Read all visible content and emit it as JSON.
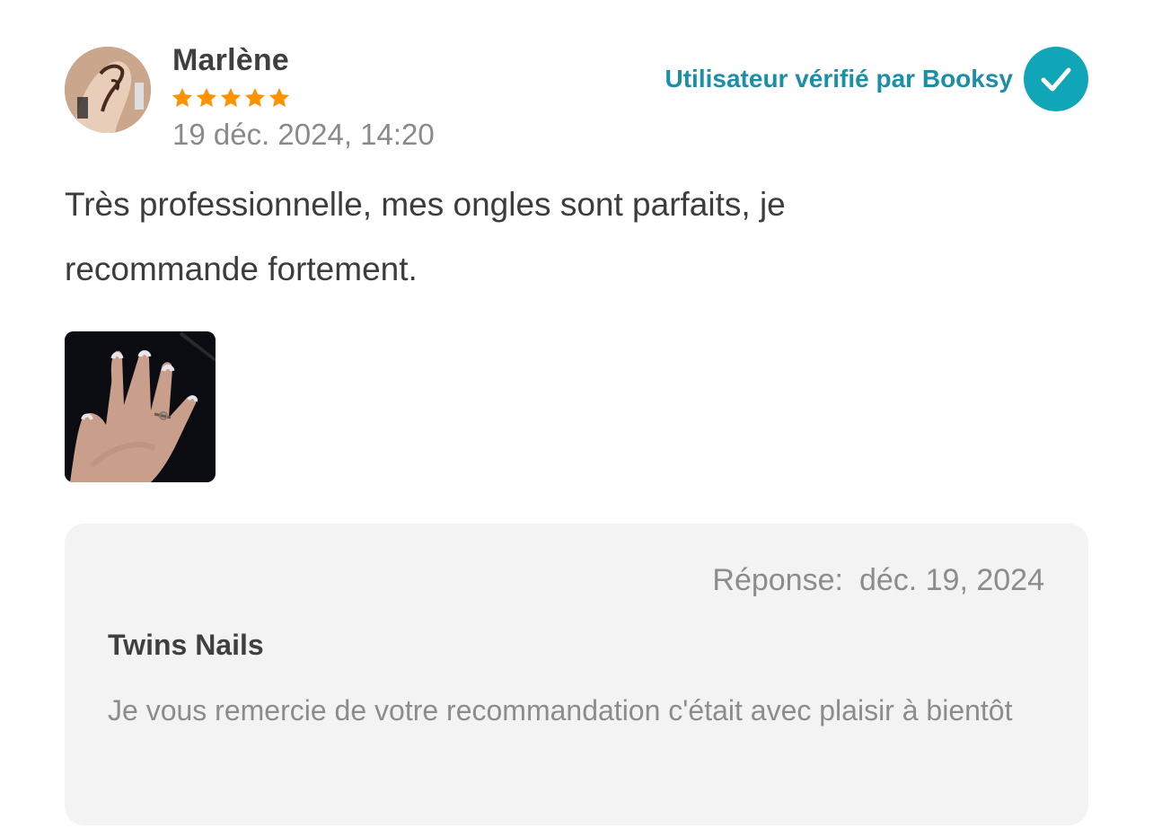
{
  "review": {
    "author": "Marlène",
    "rating": 5,
    "rating_max": 5,
    "date": "19 déc. 2024, 14:20",
    "verified_label": "Utilisateur vérifié par Booksy",
    "text": "Très professionnelle, mes ongles sont parfaits, je recommande fortement."
  },
  "reply": {
    "label": "Réponse:",
    "date": "déc. 19, 2024",
    "author": "Twins Nails",
    "text": "Je vous remercie de votre recommandation c'était avec plaisir à bientôt"
  },
  "icons": {
    "avatar": "avatar-photo",
    "star": "star-icon",
    "verified": "check-icon",
    "photo": "review-photo"
  },
  "colors": {
    "star": "#ff9200",
    "verified_text": "#1c8fa8",
    "verified_badge": "#10a6b8",
    "reply_background": "#f3f3f3"
  }
}
